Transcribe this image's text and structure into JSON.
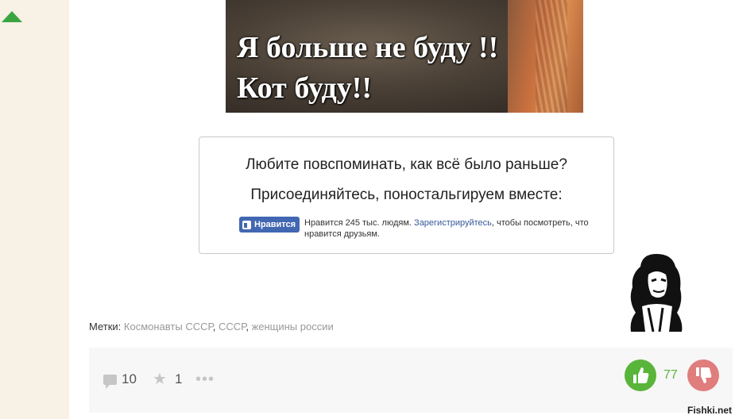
{
  "meme": {
    "caption_line1": "Я больше не буду !!",
    "caption_line2": "Кот буду!!"
  },
  "promo": {
    "line1": "Любите повспоминать, как всё было раньше?",
    "line2": "Присоединяйтесь, поностальгируем вместе:",
    "like_button_label": "Нравится",
    "like_text_before": "Нравится 245 тыс. людям. ",
    "like_register_link": "Зарегистрируйтесь",
    "like_text_after": ", чтобы посмотреть, что нравится друзьям."
  },
  "tags": {
    "label": "Метки: ",
    "items": [
      "Космонавты СССР",
      "СССР",
      "женщины россии"
    ]
  },
  "footer": {
    "comments_count": "10",
    "favorites_count": "1",
    "more_label": "•••",
    "rating": "77"
  },
  "watermark": "Fishki.net",
  "colors": {
    "accent_green": "#59b43a",
    "downvote_red": "#e07d7d",
    "facebook_blue": "#4267b2",
    "rail_bg": "#f8f1e5"
  },
  "icons": [
    "scroll-up-icon",
    "thumbs-up-icon",
    "comment-icon",
    "star-icon",
    "more-icon",
    "thumb-up-vote-icon",
    "thumb-down-vote-icon"
  ]
}
